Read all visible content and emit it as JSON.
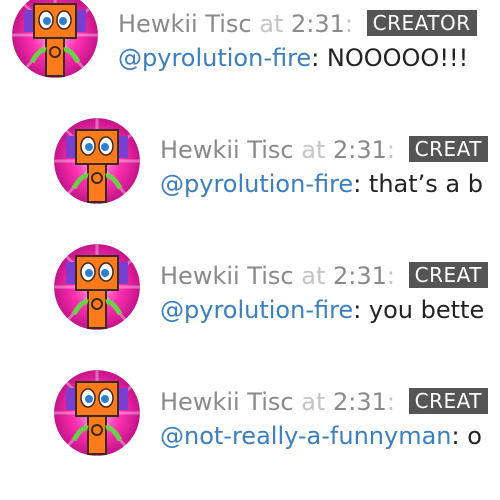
{
  "colors": {
    "author": "#8a8a8a",
    "muted": "#c4c4c4",
    "badge_bg": "#555555",
    "badge_text": "#ffffff",
    "mention": "#3a7fc0",
    "text": "#222222"
  },
  "comments": [
    {
      "author": "Hewkii Tisc",
      "at": "at",
      "time": "2:31",
      "colon": ":",
      "badge": "CREATOR",
      "mention": "@pyrolution-fire",
      "text": ": NOOOOO!!!",
      "avatar_icon": "robot-avatar-icon"
    },
    {
      "author": "Hewkii Tisc",
      "at": "at",
      "time": "2:31",
      "colon": ":",
      "badge": "CREAT",
      "mention": "@pyrolution-fire",
      "text": ": that’s a b",
      "avatar_icon": "robot-avatar-icon"
    },
    {
      "author": "Hewkii Tisc",
      "at": "at",
      "time": "2:31",
      "colon": ":",
      "badge": "CREAT",
      "mention": "@pyrolution-fire",
      "text": ": you bette",
      "avatar_icon": "robot-avatar-icon"
    },
    {
      "author": "Hewkii Tisc",
      "at": "at",
      "time": "2:31",
      "colon": ":",
      "badge": "CREAT",
      "mention": "@not-really-a-funnyman",
      "text": ": o",
      "avatar_icon": "robot-avatar-icon"
    }
  ]
}
